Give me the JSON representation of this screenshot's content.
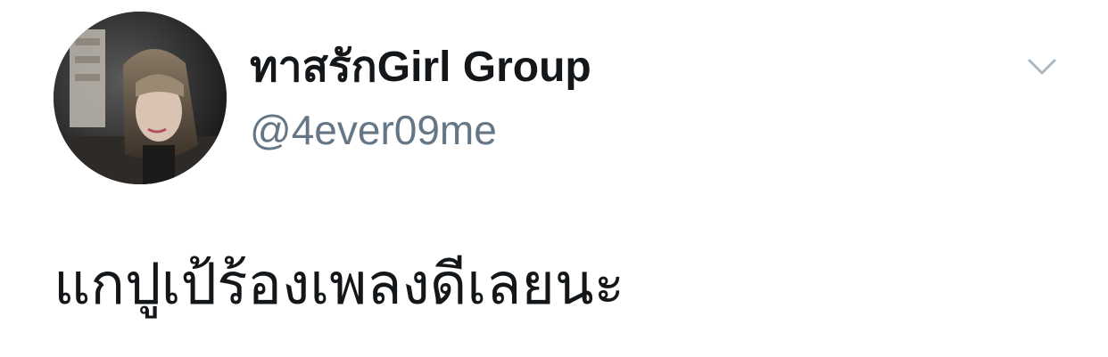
{
  "tweet": {
    "author": {
      "display_name": "ทาสรักGirl Group",
      "handle": "@4ever09me",
      "avatar": "profile-photo"
    },
    "menu_icon": "chevron-down-icon",
    "text": "แกปูเป้ร้องเพลงดีเลยนะ"
  },
  "colors": {
    "name": "#14171a",
    "handle": "#657786",
    "chevron": "#aab8c2",
    "background": "#ffffff"
  }
}
